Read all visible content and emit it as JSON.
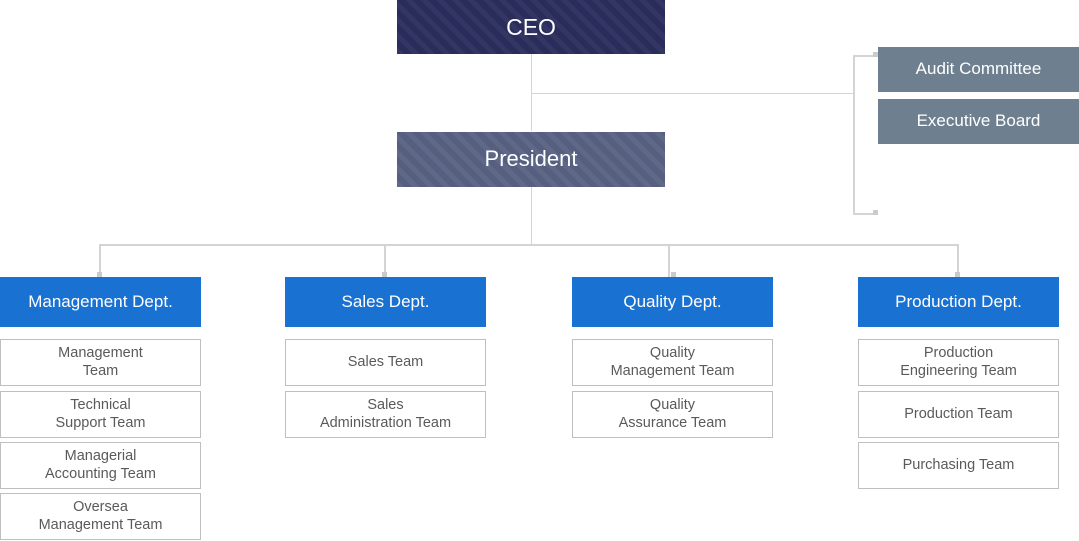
{
  "chart": {
    "type": "organization-chart",
    "title": "",
    "nodes": {
      "ceo": {
        "label": "CEO",
        "color": "#2a2d5c"
      },
      "president": {
        "label": "President",
        "color": "#565f80"
      },
      "audit_committee": {
        "label": "Audit Committee",
        "color": "#6e8090"
      },
      "executive_board": {
        "label": "Executive Board",
        "color": "#6e8090"
      }
    },
    "departments": [
      {
        "label": "Management Dept.",
        "color": "#1971d1",
        "teams": [
          {
            "line1": "Management",
            "line2": "Team"
          },
          {
            "line1": "Technical",
            "line2": "Support Team"
          },
          {
            "line1": "Managerial",
            "line2": "Accounting Team"
          },
          {
            "line1": "Oversea",
            "line2": "Management Team"
          }
        ]
      },
      {
        "label": "Sales Dept.",
        "color": "#1971d1",
        "teams": [
          {
            "line1": "Sales Team",
            "line2": ""
          },
          {
            "line1": "Sales",
            "line2": "Administration Team"
          }
        ]
      },
      {
        "label": "Quality Dept.",
        "color": "#1971d1",
        "teams": [
          {
            "line1": "Quality",
            "line2": "Management Team"
          },
          {
            "line1": "Quality",
            "line2": "Assurance Team"
          }
        ]
      },
      {
        "label": "Production Dept.",
        "color": "#1971d1",
        "teams": [
          {
            "line1": "Production",
            "line2": "Engineering Team"
          },
          {
            "line1": "Production Team",
            "line2": ""
          },
          {
            "line1": "Purchasing Team",
            "line2": ""
          }
        ]
      }
    ],
    "colors": {
      "connector": "#d2d4d6",
      "team_border": "#bfbfbf",
      "team_text": "#5a5a5a"
    }
  }
}
